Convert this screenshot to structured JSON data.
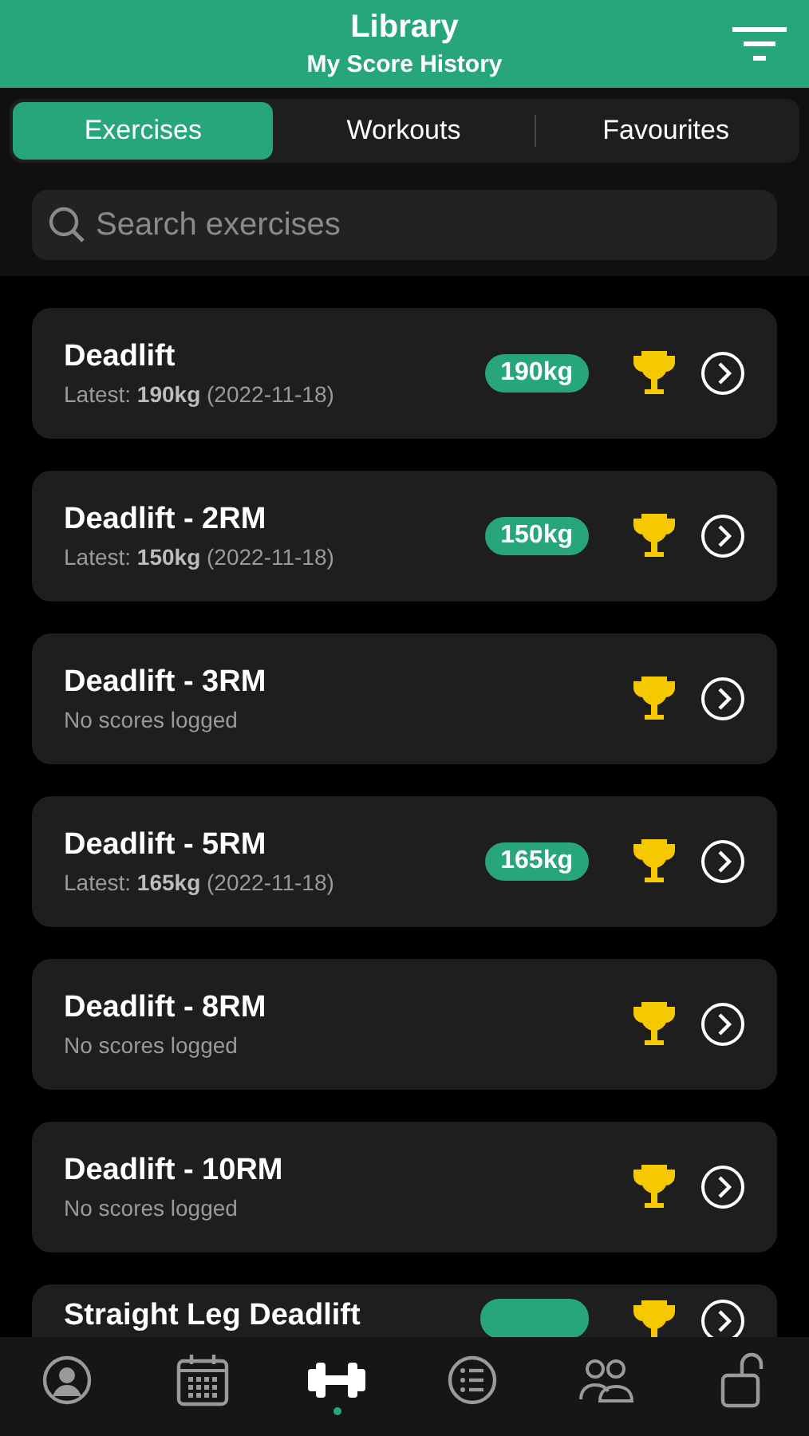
{
  "header": {
    "title": "Library",
    "subtitle": "My Score History"
  },
  "tabs": [
    {
      "label": "Exercises",
      "selected": true
    },
    {
      "label": "Workouts",
      "selected": false
    },
    {
      "label": "Favourites",
      "selected": false
    }
  ],
  "search": {
    "placeholder": "Search exercises"
  },
  "exercises": [
    {
      "name": "Deadlift",
      "detail": "Latest: **190kg** (2022-11-18)",
      "badge": "190kg"
    },
    {
      "name": "Deadlift - 2RM",
      "detail": "Latest: **150kg** (2022-11-18)",
      "badge": "150kg"
    },
    {
      "name": "Deadlift - 3RM",
      "detail": "No scores logged"
    },
    {
      "name": "Deadlift - 5RM",
      "detail": "Latest: **165kg** (2022-11-18)",
      "badge": "165kg"
    },
    {
      "name": "Deadlift - 8RM",
      "detail": "No scores logged"
    },
    {
      "name": "Deadlift - 10RM",
      "detail": "No scores logged"
    },
    {
      "name": "Straight Leg Deadlift",
      "has_badge": true
    }
  ],
  "nav": [
    {
      "kind": "profile",
      "selected": false
    },
    {
      "kind": "calendar",
      "selected": false
    },
    {
      "kind": "dumbbell",
      "selected": true
    },
    {
      "kind": "list",
      "selected": false
    },
    {
      "kind": "people",
      "selected": false
    },
    {
      "kind": "lock",
      "selected": false
    }
  ]
}
